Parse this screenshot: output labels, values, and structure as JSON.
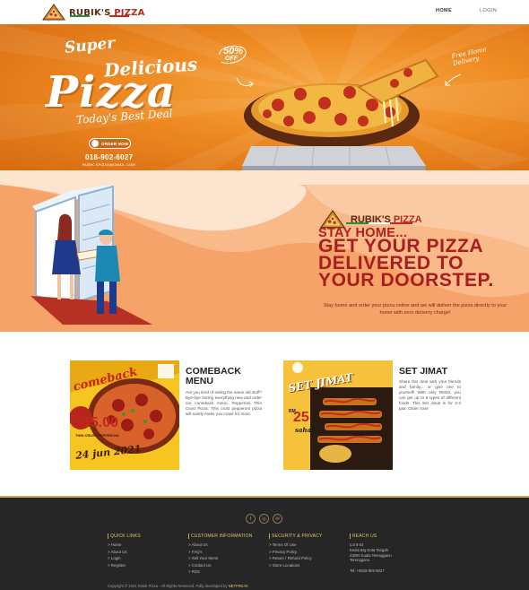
{
  "nav": {
    "brand_main": "RUBIK'S ",
    "brand_accent": "PIZZA",
    "links": [
      "HOME",
      "LOGIN"
    ]
  },
  "hero": {
    "super": "Super",
    "delicious": "Delicious",
    "pizza": "Pizza",
    "tagline": "Today's Best Deal",
    "discount": "50%",
    "discount_sub": "OFF",
    "free_delivery": "Free Home Delivery",
    "order_button": "ORDER NOW",
    "phone": "018-902-6027",
    "website": "RUBIK-SPIZZA@GMAIL.COM"
  },
  "promo": {
    "brand_main": "RUBIK'S ",
    "brand_accent": "PIZZA",
    "headline_small": "STAY HOME...",
    "headline_lines": [
      "GET YOUR PIZZA",
      "DELIVERED TO",
      "YOUR DOORSTEP."
    ],
    "description": "Stay home and order your pizza online and we will deliver the pizza directly to your home with zero delivery charge!"
  },
  "menu": [
    {
      "title_lines": [
        "COMEBACK",
        "MENU"
      ],
      "image_banner": "comeback",
      "image_price_prefix": "RM",
      "image_price": "15.00",
      "image_price_sub": "THIN CRUST PEPPERONI",
      "image_date": "24 jun 2021",
      "description": "Are you tired of eating the same old stuff? Bye-bye boring everything new and order our comeback menu, Pepperoni Thin Crust Pizza. This crust pepperoni pizza will surely make you crave for more."
    },
    {
      "title_lines": [
        "SET JIMAT"
      ],
      "image_banner": "SET JIMAT",
      "image_price_prefix": "RM",
      "image_price": "25",
      "image_price_sub": "sahaja",
      "description": "Share this deal with your friends and family... or give one to yourself! With only RM25, you can get up to 6 types of different foods. This Set Jimat is for 2-3 pax. Order now!"
    }
  ],
  "footer": {
    "social_icons": [
      "facebook-icon",
      "instagram-icon",
      "email-icon"
    ],
    "columns": [
      {
        "heading": "QUICK LINKS",
        "items": [
          "> Home",
          "> About Us",
          "> Login",
          "> Register"
        ]
      },
      {
        "heading": "CUSTOMER INFORMATION",
        "items": [
          "> About Us",
          "> FAQ's",
          "> Sell Your Items",
          "> Contact Us",
          "> RSS"
        ]
      },
      {
        "heading": "SECURITY & PRIVACY",
        "items": [
          "> Terms Of Use",
          "> Privacy Policy",
          "> Return / Refund Policy",
          "> Store Locations"
        ]
      },
      {
        "heading": "REACH US",
        "lines": [
          "Lot 8-03",
          "Kedai Brg Kota Tengah",
          "23000 Kuala Terengganu",
          "Terengganu"
        ],
        "phone": "Tel: +6018-902-6027"
      }
    ],
    "copyright_prefix": "Copyright © 2021 Rubik Pizza - All Rights Reserved. Fully developed by ",
    "copyright_brand": "NETFREAK"
  },
  "colors": {
    "hero_orange": "#ee8a21",
    "promo_peach": "#f9b988",
    "headline_red": "#a81d1d",
    "brand_brown": "#5b2a14",
    "footer_bg": "#262626",
    "footer_gold": "#c6a85a"
  }
}
